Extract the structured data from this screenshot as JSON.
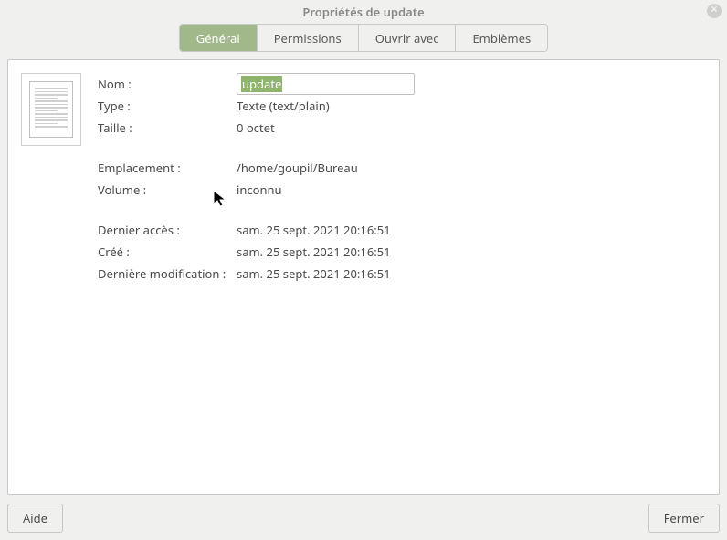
{
  "window": {
    "title": "Propriétés de update"
  },
  "tabs": {
    "general": "Général",
    "permissions": "Permissions",
    "open_with": "Ouvrir avec",
    "emblems": "Emblèmes"
  },
  "props": {
    "name_label": "Nom :",
    "name_value": "update",
    "type_label": "Type :",
    "type_value": "Texte (text/plain)",
    "size_label": "Taille :",
    "size_value": "0 octet",
    "location_label": "Emplacement :",
    "location_value": "/home/goupil/Bureau",
    "volume_label": "Volume :",
    "volume_value": "inconnu",
    "accessed_label": "Dernier accès :",
    "accessed_value": "sam. 25 sept. 2021 20:16:51",
    "created_label": "Créé :",
    "created_value": "sam. 25 sept. 2021 20:16:51",
    "modified_label": "Dernière modification :",
    "modified_value": "sam. 25 sept. 2021 20:16:51"
  },
  "buttons": {
    "help": "Aide",
    "close": "Fermer"
  }
}
